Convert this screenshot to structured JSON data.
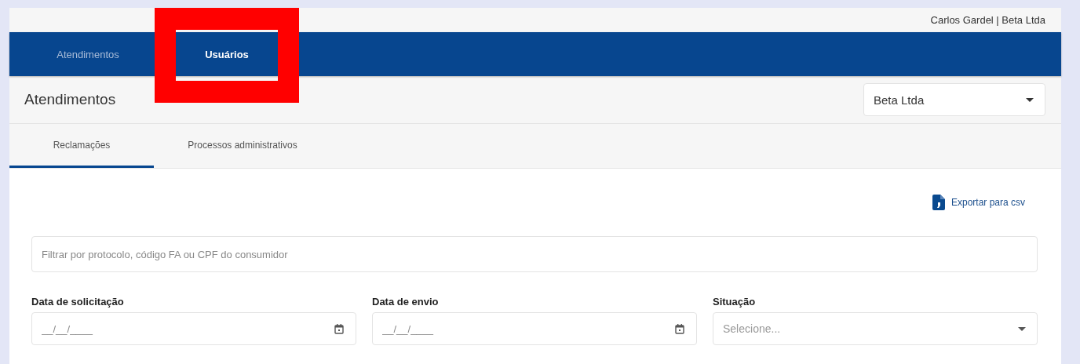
{
  "user_label": "Carlos Gardel | Beta Ltda",
  "nav_tabs": [
    {
      "label": "Atendimentos",
      "selected": false
    },
    {
      "label": "Usuários",
      "selected": true
    }
  ],
  "page_title": "Atendimentos",
  "company_select": {
    "value": "Beta Ltda"
  },
  "sub_tabs": [
    {
      "label": "Reclamações",
      "selected": true
    },
    {
      "label": "Processos administrativos",
      "selected": false
    }
  ],
  "export_link": "Exportar para csv",
  "search": {
    "placeholder": "Filtrar por protocolo, código FA ou CPF do consumidor"
  },
  "filters": [
    {
      "kind": "date",
      "label": "Data de solicitação",
      "placeholder": "__/__/____"
    },
    {
      "kind": "date",
      "label": "Data de envio",
      "placeholder": "__/__/____"
    },
    {
      "kind": "select",
      "label": "Situação",
      "placeholder": "Selecione..."
    }
  ]
}
